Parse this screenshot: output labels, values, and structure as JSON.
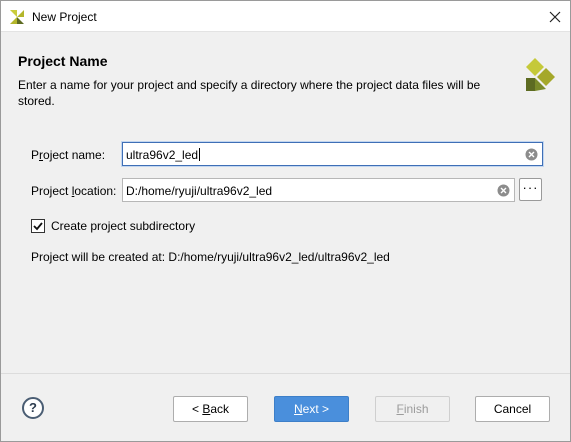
{
  "window": {
    "title": "New Project",
    "icon": "xilinx-logo-icon"
  },
  "header": {
    "title": "Project Name",
    "description": "Enter a name for your project and specify a directory where the project data files will be stored."
  },
  "form": {
    "project_name": {
      "label_prefix": "P",
      "label_mnemonic": "r",
      "label_rest": "oject name:",
      "value": "ultra96v2_led"
    },
    "project_location": {
      "label_prefix": "Project ",
      "label_mnemonic": "l",
      "label_rest": "ocation:",
      "value": "D:/home/ryuji/ultra96v2_led",
      "browse_label": "···"
    },
    "create_subdirectory": {
      "label": "Create project subdirectory",
      "checked": true
    },
    "created_at": "Project will be created at: D:/home/ryuji/ultra96v2_led/ultra96v2_led"
  },
  "footer": {
    "help_label": "?",
    "back": {
      "prefix": "< ",
      "mnemonic": "B",
      "rest": "ack"
    },
    "next": {
      "mnemonic": "N",
      "rest": "ext >"
    },
    "finish": {
      "mnemonic": "F",
      "rest": "inish"
    },
    "cancel": "Cancel"
  },
  "colors": {
    "accent": "#4a8fdc",
    "logo_green": "#b3b62b",
    "logo_dark": "#5d6b22"
  }
}
